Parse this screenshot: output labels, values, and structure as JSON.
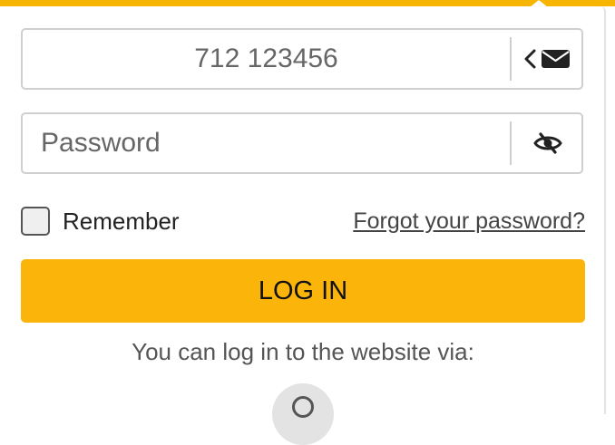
{
  "login_form": {
    "phone_value": "712 123456",
    "password_placeholder": "Password",
    "remember_label": "Remember",
    "forgot_link": "Forgot your password?",
    "login_button": "LOG IN",
    "via_text": "You can log in to the website via:"
  },
  "colors": {
    "accent": "#fbb50a",
    "top_bar": "#f7b500",
    "field_border": "#cfcfcf"
  },
  "icons": {
    "contact_toggle": [
      "chevron-left-icon",
      "envelope-icon"
    ],
    "password_toggle": "eye-slash-icon",
    "social": "social-login-icon"
  }
}
